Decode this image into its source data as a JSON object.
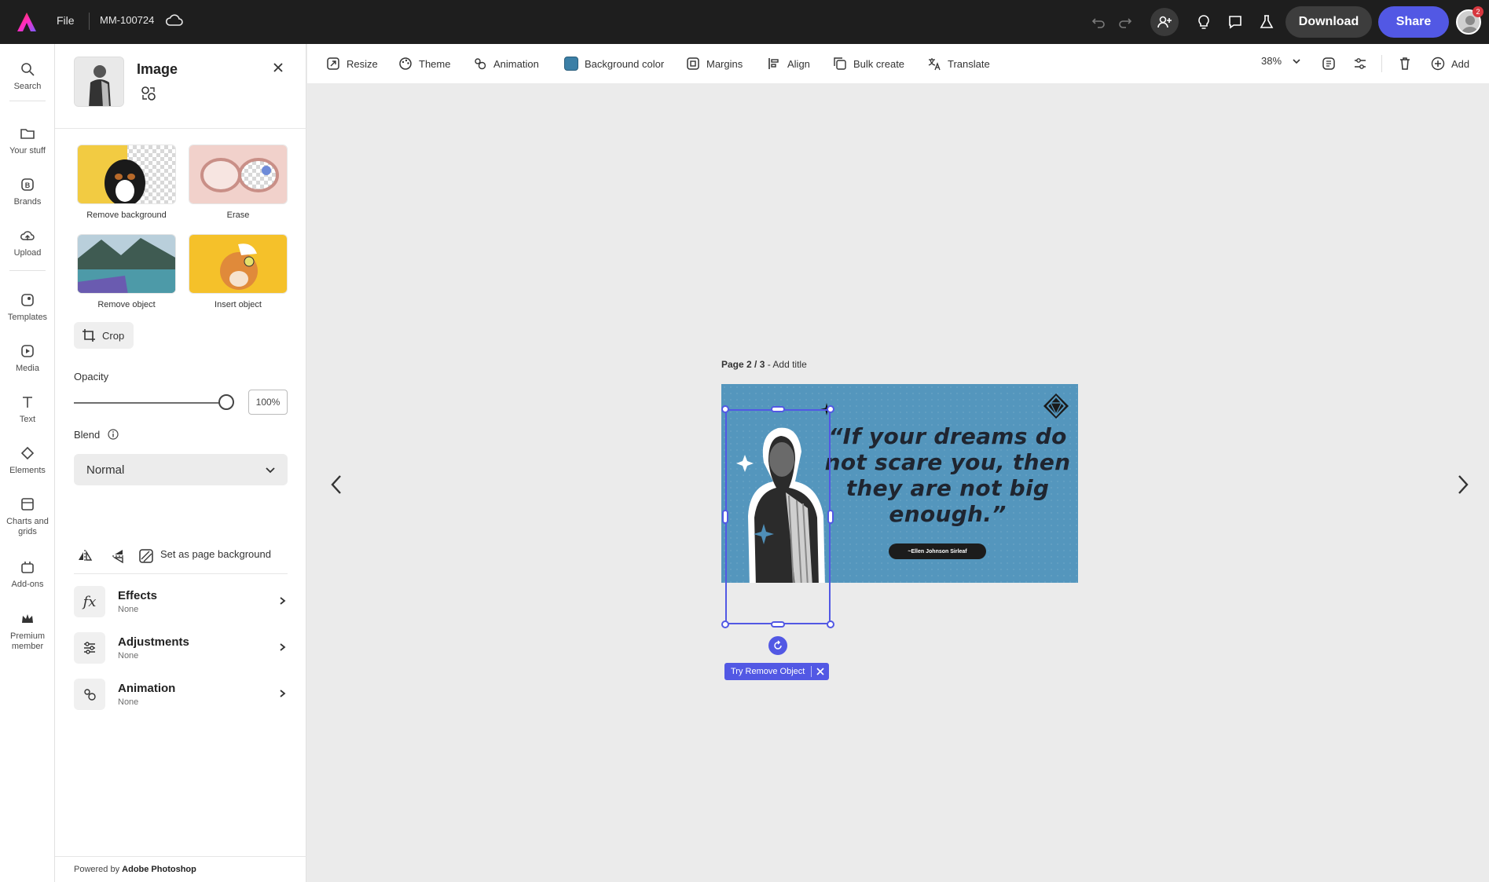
{
  "topbar": {
    "file_label": "File",
    "doc_name": "MM-100724",
    "download_label": "Download",
    "share_label": "Share",
    "notification_count": "2"
  },
  "rail": {
    "items": [
      {
        "label": "Search",
        "icon": "search-icon"
      },
      {
        "label": "Your stuff",
        "icon": "folder-icon"
      },
      {
        "label": "Brands",
        "icon": "brand-icon"
      },
      {
        "label": "Upload",
        "icon": "upload-icon"
      },
      {
        "label": "Templates",
        "icon": "templates-icon"
      },
      {
        "label": "Media",
        "icon": "media-icon"
      },
      {
        "label": "Text",
        "icon": "text-icon"
      },
      {
        "label": "Elements",
        "icon": "elements-icon"
      },
      {
        "label": "Charts and grids",
        "icon": "charts-icon"
      },
      {
        "label": "Add-ons",
        "icon": "addons-icon"
      },
      {
        "label": "Premium member",
        "icon": "crown-icon"
      }
    ]
  },
  "panel": {
    "title": "Image",
    "tools": [
      {
        "label": "Remove background"
      },
      {
        "label": "Erase"
      },
      {
        "label": "Remove object"
      },
      {
        "label": "Insert object"
      }
    ],
    "crop_label": "Crop",
    "opacity_label": "Opacity",
    "opacity_value": "100%",
    "opacity_fraction": 1.0,
    "blend_label": "Blend",
    "blend_value": "Normal",
    "set_bg_label": "Set as page background",
    "accordions": [
      {
        "title": "Effects",
        "sub": "None"
      },
      {
        "title": "Adjustments",
        "sub": "None"
      },
      {
        "title": "Animation",
        "sub": "None"
      }
    ],
    "powered_prefix": "Powered by",
    "powered_brand": "Adobe Photoshop"
  },
  "toolbar": {
    "items": [
      "Resize",
      "Theme",
      "Animation",
      "Background color",
      "Margins",
      "Align",
      "Bulk create",
      "Translate"
    ],
    "zoom": "38%",
    "add_label": "Add",
    "bg_color": "#3b7fa6"
  },
  "canvas": {
    "page_label": "Page 2 / 3",
    "page_title_sep": " - ",
    "page_title": "Add title",
    "quote": "“If your dreams do not scare you, then they are not big enough.”",
    "attribution": "~Ellen Johnson Sirleaf",
    "try_remove_label": "Try Remove Object"
  },
  "colors": {
    "accent": "#5258e4",
    "design_bg": "#5496bd",
    "topbar": "#1e1e1e"
  }
}
